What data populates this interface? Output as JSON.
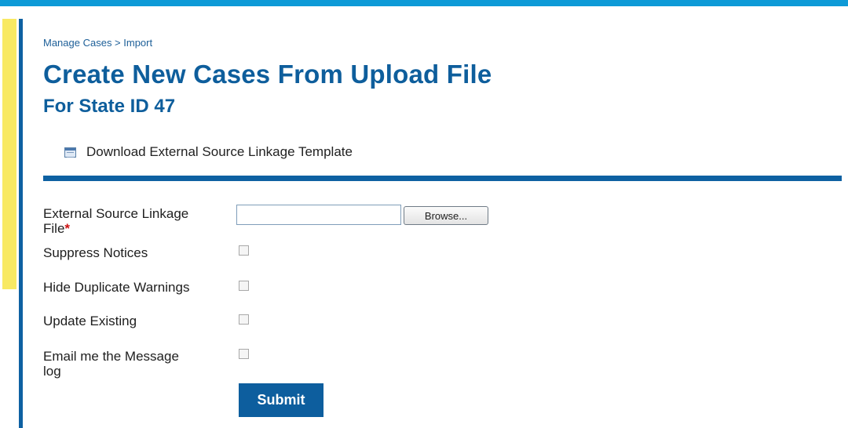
{
  "breadcrumb": "Manage Cases > Import",
  "page": {
    "title": "Create New Cases From Upload File",
    "subtitle": "For State ID 47"
  },
  "download_link": {
    "label": "Download External Source Linkage Template",
    "icon": "document-list-icon"
  },
  "form": {
    "file_field": {
      "label_line1": "External Source Linkage",
      "label_line2": "File",
      "required_marker": "*",
      "value": "",
      "browse_label": "Browse..."
    },
    "checkboxes": [
      {
        "label": "Suppress Notices",
        "checked": false
      },
      {
        "label": "Hide Duplicate Warnings",
        "checked": false
      },
      {
        "label": "Update Existing",
        "checked": false
      },
      {
        "label_line1": "Email me the Message",
        "label_line2": "log",
        "checked": false
      }
    ],
    "submit_label": "Submit"
  },
  "colors": {
    "top_bar": "#0e9ad7",
    "accent_yellow": "#f8e963",
    "rail_blue": "#0e61a2",
    "title_blue": "#0e5e9c",
    "submit_blue": "#0d5e9e",
    "required_red": "#cc1111"
  }
}
